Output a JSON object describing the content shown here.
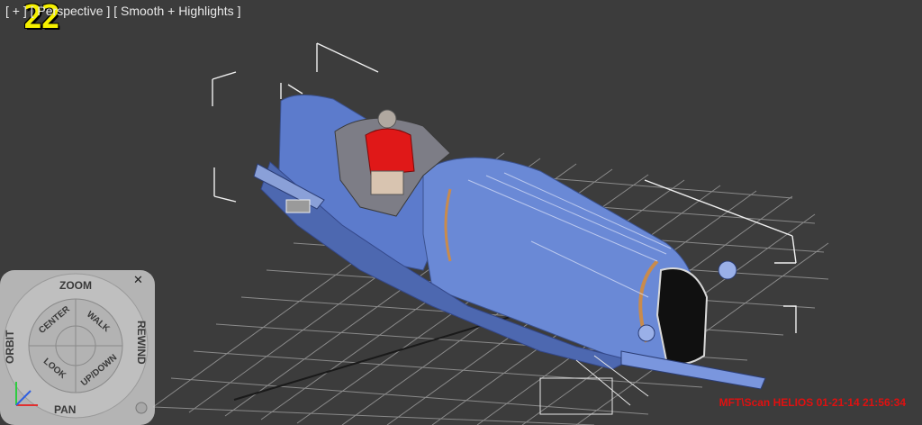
{
  "viewport": {
    "label_plus": "[ + ]",
    "label_view": "[ Perspective ]",
    "label_shading": "[ Smooth + Highlights ]",
    "frame_counter": "22"
  },
  "steering_wheel": {
    "zoom": "ZOOM",
    "orbit": "ORBIT",
    "rewind": "REWIND",
    "pan": "PAN",
    "center": "CENTER",
    "walk": "WALK",
    "look": "LOOK",
    "updown": "UP/DOWN",
    "close": "✕"
  },
  "watermark": "MFT\\Scan HELIOS 01-21-14 21:56:34",
  "colors": {
    "viewport_bg": "#3c3c3c",
    "car_body": "#5f7fd0",
    "driver": "#e01818",
    "frame_counter": "#f5f000"
  }
}
